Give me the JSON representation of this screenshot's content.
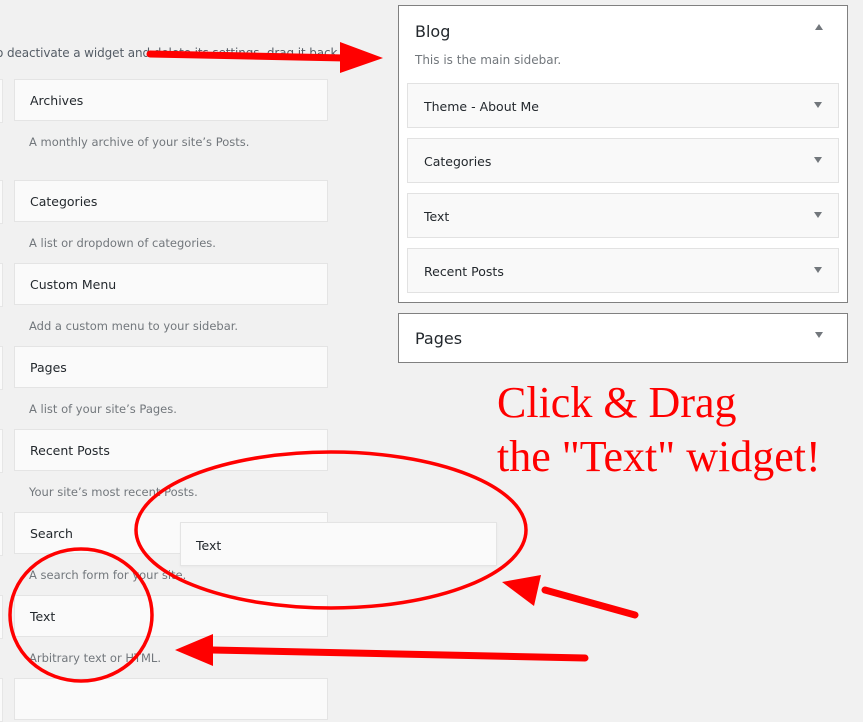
{
  "intro_text": "o deactivate a widget and delete its settings, drag it back.",
  "available_widgets": [
    {
      "title": "Archives",
      "description": "A monthly archive of your site’s Posts."
    },
    {
      "title": "Categories",
      "description": "A list or dropdown of categories."
    },
    {
      "title": "Custom Menu",
      "description": "Add a custom menu to your sidebar."
    },
    {
      "title": "Pages",
      "description": "A list of your site’s Pages."
    },
    {
      "title": "Recent Posts",
      "description": "Your site’s most recent Posts."
    },
    {
      "title": "Search",
      "description": "A search form for your site."
    },
    {
      "title": "Text",
      "description": "Arbitrary text or HTML."
    }
  ],
  "dragging_widget": {
    "title": "Text"
  },
  "sidebars": [
    {
      "title": "Blog",
      "description": "This is the main sidebar.",
      "expanded": true,
      "widgets": [
        {
          "title": "Theme - About Me"
        },
        {
          "title": "Categories"
        },
        {
          "title": "Text"
        },
        {
          "title": "Recent Posts"
        }
      ]
    },
    {
      "title": "Pages",
      "expanded": false
    }
  ],
  "annotation": {
    "line1": "Click & Drag",
    "line2": "the \"Text\" widget!",
    "color": "#ff0000"
  }
}
